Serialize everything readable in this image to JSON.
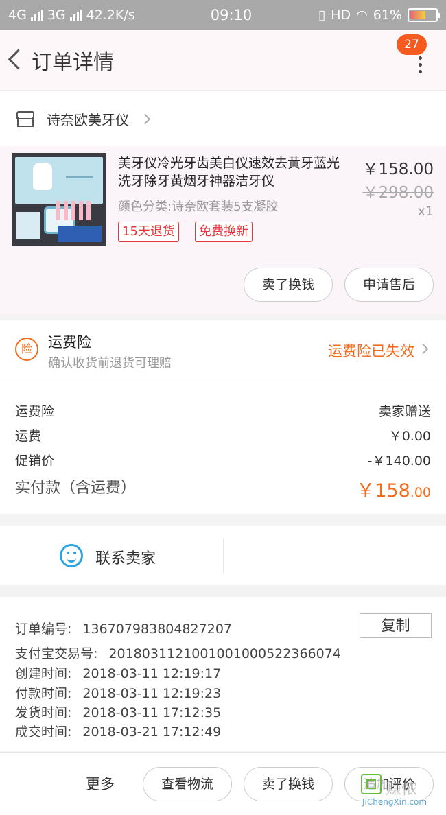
{
  "status_bar": {
    "net1": "4G",
    "net2": "3G",
    "speed": "42.2K/s",
    "time": "09:10",
    "hd": "HD",
    "battery": "61%",
    "battery_level": 0.61
  },
  "nav": {
    "title": "订单详情",
    "badge": "27"
  },
  "shop": {
    "name": "诗奈欧美牙仪"
  },
  "product": {
    "title": "美牙仪冷光牙齿美白仪速效去黄牙蓝光洗牙除牙黄烟牙神器洁牙仪",
    "spec": "颜色分类:诗奈欧套装5支凝胶",
    "price": "￥158.00",
    "original_price": "￥298.00",
    "quantity": "x1",
    "tags": [
      "15天退货",
      "免费换新"
    ],
    "buttons": [
      "卖了换钱",
      "申请售后"
    ]
  },
  "insurance": {
    "icon_text": "险",
    "title": "运费险",
    "subtitle": "确认收货前退货可理赔",
    "status": "运费险已失效"
  },
  "fees": [
    {
      "label": "运费险",
      "value": "卖家赠送"
    },
    {
      "label": "运费",
      "value": "￥0.00"
    },
    {
      "label": "促销价",
      "value": "-￥140.00"
    }
  ],
  "total": {
    "label": "实付款（含运费）",
    "main": "￥158",
    "decimal": ".00"
  },
  "contact": {
    "label": "联系卖家"
  },
  "order_info": {
    "order_no_label": "订单编号:",
    "order_no": "136707983804827207",
    "copy_label": "复制",
    "alipay_label": "支付宝交易号:",
    "alipay_no": "2018031121001001000522366074",
    "created_label": "创建时间:",
    "created": "2018-03-11 12:19:17",
    "paid_label": "付款时间:",
    "paid": "2018-03-11 12:19:23",
    "shipped_label": "发货时间:",
    "shipped": "2018-03-11 17:12:35",
    "done_label": "成交时间:",
    "done": "2018-03-21 17:12:49"
  },
  "bottom_bar": {
    "more": "更多",
    "buttons": [
      "查看物流",
      "卖了换钱",
      "追加评价"
    ]
  },
  "watermark": {
    "text": "赚侬",
    "url": "JiChengXin.com"
  },
  "colors": {
    "accent": "#f46b1e",
    "tag_red": "#e8353a",
    "contact_blue": "#2ba5e8"
  }
}
